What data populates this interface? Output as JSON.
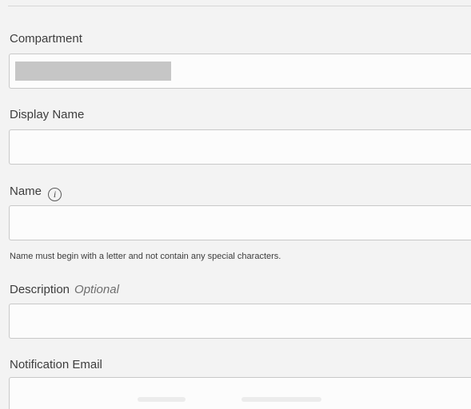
{
  "form": {
    "compartment": {
      "label": "Compartment",
      "value": ""
    },
    "display_name": {
      "label": "Display Name",
      "value": "",
      "placeholder": ""
    },
    "name": {
      "label": "Name",
      "info_icon": "info-icon",
      "value": "",
      "placeholder": "",
      "hint": "Name must begin with a letter and not contain any special characters."
    },
    "description": {
      "label": "Description",
      "optional_tag": "Optional",
      "value": "",
      "placeholder": ""
    },
    "notification_email": {
      "label": "Notification Email",
      "value": ""
    }
  },
  "colors": {
    "background": "#f3f3f3",
    "field_background": "#fcfcfc",
    "field_border": "#c8c8c8",
    "label_text": "#3d3d3d",
    "redacted_block": "#c6c6c6"
  }
}
